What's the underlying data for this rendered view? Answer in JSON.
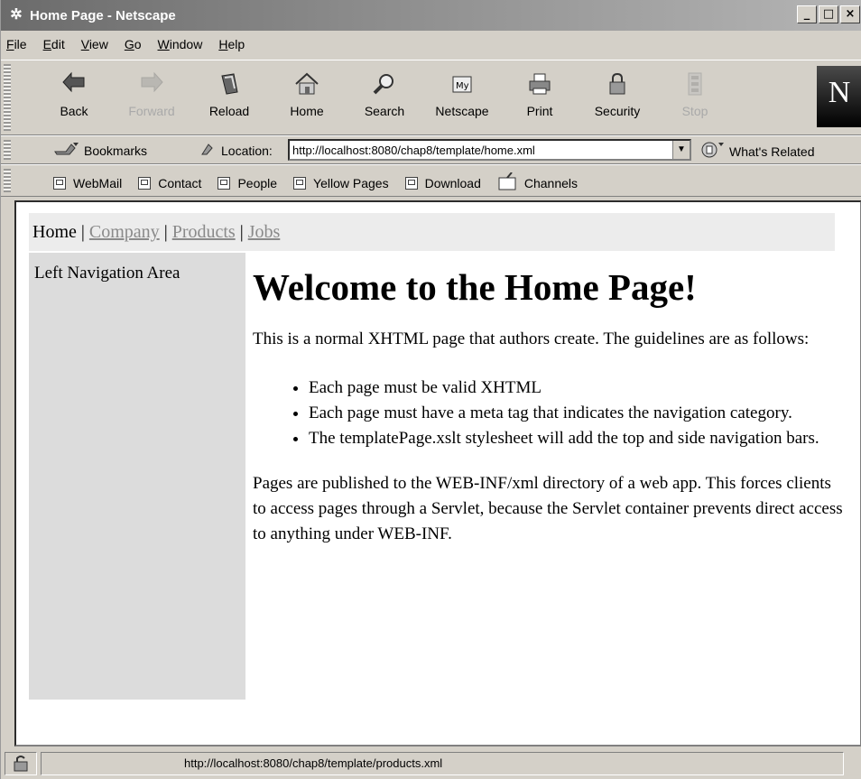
{
  "window": {
    "title": "Home Page - Netscape"
  },
  "menubar": {
    "items": [
      "File",
      "Edit",
      "View",
      "Go",
      "Window",
      "Help"
    ]
  },
  "navbar": {
    "buttons": [
      {
        "label": "Back",
        "icon": "back-arrow-icon",
        "enabled": true
      },
      {
        "label": "Forward",
        "icon": "forward-arrow-icon",
        "enabled": false
      },
      {
        "label": "Reload",
        "icon": "reload-icon",
        "enabled": true
      },
      {
        "label": "Home",
        "icon": "home-icon",
        "enabled": true
      },
      {
        "label": "Search",
        "icon": "search-icon",
        "enabled": true
      },
      {
        "label": "Netscape",
        "icon": "netscape-icon",
        "enabled": true
      },
      {
        "label": "Print",
        "icon": "printer-icon",
        "enabled": true
      },
      {
        "label": "Security",
        "icon": "lock-icon",
        "enabled": true
      },
      {
        "label": "Stop",
        "icon": "stop-icon",
        "enabled": false
      }
    ],
    "logo_text": "N"
  },
  "locbar": {
    "bookmarks_label": "Bookmarks",
    "location_label": "Location:",
    "url": "http://localhost:8080/chap8/template/home.xml",
    "whats_related_label": "What's Related"
  },
  "personalbar": {
    "items": [
      "WebMail",
      "Contact",
      "People",
      "Yellow Pages",
      "Download",
      "Channels"
    ]
  },
  "page": {
    "topnav": {
      "home": "Home",
      "sep": "|",
      "company": "Company",
      "products": "Products",
      "jobs": "Jobs"
    },
    "leftnav_label": "Left Navigation Area",
    "heading": "Welcome to the Home Page!",
    "intro": "This is a normal XHTML page that authors create. The guidelines are as follows:",
    "bullets": [
      "Each page must be valid XHTML",
      "Each page must have a meta tag that indicates the navigation category.",
      "The templatePage.xslt stylesheet will add the top and side navigation bars."
    ],
    "closing": "Pages are published to the WEB-INF/xml directory of a web app. This forces clients to access pages through a Servlet, because the Servlet container prevents direct access to anything under WEB-INF."
  },
  "statusbar": {
    "text": "http://localhost:8080/chap8/template/products.xml"
  },
  "colors": {
    "chrome": "#d4d0c8",
    "topnav_bg": "#ececec",
    "leftnav_bg": "#dcdcdc",
    "link": "#8a8a8a"
  }
}
